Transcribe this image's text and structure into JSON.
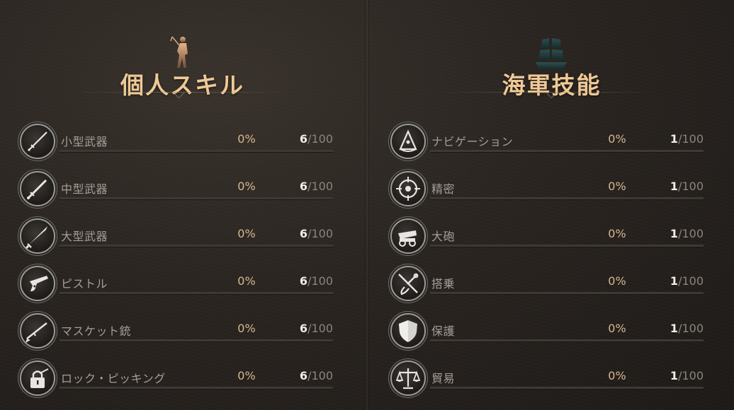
{
  "personal": {
    "title": "個人スキル",
    "emblem": "swordsman-silhouette-icon",
    "skills": [
      {
        "name": "小型武器",
        "percent": "0%",
        "level": "6",
        "max": "/100",
        "icon": "small-weapon-icon"
      },
      {
        "name": "中型武器",
        "percent": "0%",
        "level": "6",
        "max": "/100",
        "icon": "medium-weapon-icon"
      },
      {
        "name": "大型武器",
        "percent": "0%",
        "level": "6",
        "max": "/100",
        "icon": "large-weapon-icon"
      },
      {
        "name": "ピストル",
        "percent": "0%",
        "level": "6",
        "max": "/100",
        "icon": "pistol-icon"
      },
      {
        "name": "マスケット銃",
        "percent": "0%",
        "level": "6",
        "max": "/100",
        "icon": "musket-icon"
      },
      {
        "name": "ロック・ピッキング",
        "percent": "0%",
        "level": "6",
        "max": "/100",
        "icon": "lockpick-icon"
      }
    ]
  },
  "naval": {
    "title": "海軍技能",
    "emblem": "ship-icon",
    "skills": [
      {
        "name": "ナビゲーション",
        "percent": "0%",
        "level": "1",
        "max": "/100",
        "icon": "sextant-icon"
      },
      {
        "name": "精密",
        "percent": "0%",
        "level": "1",
        "max": "/100",
        "icon": "crosshair-icon"
      },
      {
        "name": "大砲",
        "percent": "0%",
        "level": "1",
        "max": "/100",
        "icon": "cannon-icon"
      },
      {
        "name": "搭乗",
        "percent": "0%",
        "level": "1",
        "max": "/100",
        "icon": "boarding-icon"
      },
      {
        "name": "保護",
        "percent": "0%",
        "level": "1",
        "max": "/100",
        "icon": "shield-icon"
      },
      {
        "name": "貿易",
        "percent": "0%",
        "level": "1",
        "max": "/100",
        "icon": "scales-icon"
      }
    ]
  },
  "progress_fraction": 0,
  "colors": {
    "accent": "#efc996",
    "percent": "#d7b890",
    "label": "#a69d96",
    "track": "#3e3934"
  }
}
